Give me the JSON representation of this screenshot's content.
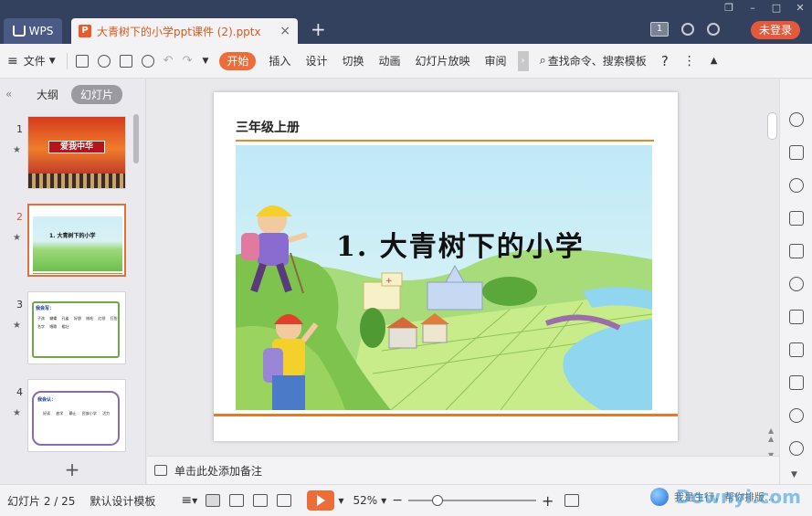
{
  "titlebar": {
    "app_tab": "WPS",
    "doc_tab": "大青树下的小学ppt课件 (2).pptx",
    "new_tab": "+",
    "login": "未登录",
    "badge": "1"
  },
  "toolbar": {
    "file": "文件",
    "tabs": [
      "开始",
      "插入",
      "设计",
      "切换",
      "动画",
      "幻灯片放映",
      "审阅"
    ],
    "search": "查找命令、搜索模板",
    "help": "?"
  },
  "leftpanel": {
    "tabs": [
      "大纲",
      "幻灯片"
    ],
    "slides": [
      {
        "num": "1",
        "title": "爱我中华"
      },
      {
        "num": "2",
        "title": "1. 大青树下的小学"
      },
      {
        "num": "3",
        "title": "我会写：",
        "words": [
          "子孩",
          "蝴蝶",
          "孔雀",
          "好朋",
          "绒毛",
          "红领",
          "打扮",
          "名字",
          "唱歌",
          "粗壮"
        ]
      },
      {
        "num": "4",
        "title": "我会认：",
        "words": [
          "好读",
          "放学",
          "静止",
          "民族小学",
          "活力"
        ]
      }
    ],
    "star": "★",
    "add": "+"
  },
  "slide": {
    "header": "三年级上册",
    "lesson_title": "1. 大青树下的小学"
  },
  "notes": {
    "placeholder": "单击此处添加备注"
  },
  "statusbar": {
    "slide_count": "幻灯片 2 / 25",
    "design": "默认设计模板",
    "zoom": "52%",
    "minus": "−",
    "plus": "+",
    "watermark_text": "我是生行，帮你排版…",
    "watermark_brand": "Downyi.com"
  },
  "colors": {
    "accent": "#ed6d3a",
    "titlebar": "#33405e",
    "login": "#e4583b"
  }
}
